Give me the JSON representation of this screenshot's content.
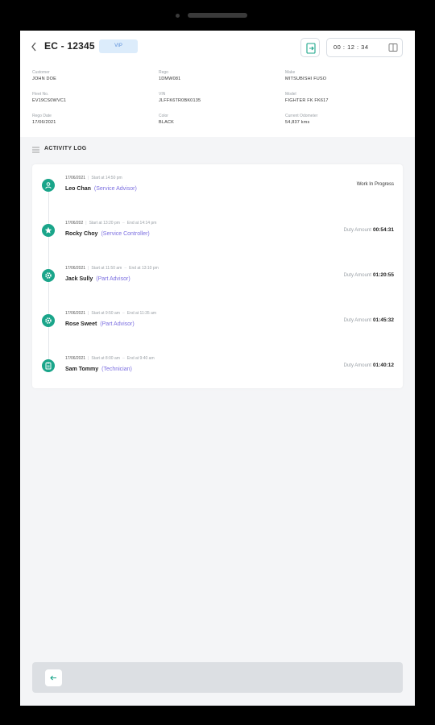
{
  "header": {
    "title": "EC - 12345",
    "badge": "VIP",
    "timer": "00 : 12 : 34"
  },
  "info": {
    "customer": {
      "label": "Customer",
      "value": "JOHN DOE"
    },
    "rego": {
      "label": "Rego",
      "value": "1DMW081"
    },
    "make": {
      "label": "Make",
      "value": "MITSUBISHI FUSO"
    },
    "fleet_no": {
      "label": "Fleet No.",
      "value": "EV19CS0WVC1"
    },
    "vin": {
      "label": "VIN",
      "value": "JLFFK6TR0BK0135"
    },
    "model": {
      "label": "Model",
      "value": "FIGHTER FK FK617"
    },
    "rego_date": {
      "label": "Rego Date",
      "value": "17/06/2021"
    },
    "color": {
      "label": "Color",
      "value": "BLACK"
    },
    "odometer": {
      "label": "Current Odometer",
      "value": "54,837 kms"
    }
  },
  "activity_log": {
    "title": "ACTIVITY LOG",
    "entries": [
      {
        "date": "17/06/2021",
        "start": "Start at 14:50 pm",
        "end": "",
        "name": "Leo Chan",
        "role": "(Service Advisor)",
        "status": "Work In Progress",
        "duty_label": "",
        "duty_value": "",
        "icon": "person-icon"
      },
      {
        "date": "17/06/202",
        "start": "Start at 13:20 pm",
        "end": "End at 14:14 pm",
        "name": "Rocky Choy",
        "role": "(Service Controller)",
        "status": "",
        "duty_label": "Duty Amount",
        "duty_value": "00:54:31",
        "icon": "star-icon"
      },
      {
        "date": "17/06/2021",
        "start": "Start at 11:50 am",
        "end": "End at 13:10 pm",
        "name": "Jack Sully",
        "role": "(Part Advisor)",
        "status": "",
        "duty_label": "Duty Amount",
        "duty_value": "01:20:55",
        "icon": "gear-icon"
      },
      {
        "date": "17/06/2021",
        "start": "Start at 9:50 am",
        "end": "End at 11:35 am",
        "name": "Rose Sweet",
        "role": "(Part Advisor)",
        "status": "",
        "duty_label": "Duty Amount",
        "duty_value": "01:45:32",
        "icon": "gear-icon"
      },
      {
        "date": "17/06/2021",
        "start": "Start at 8:00 am",
        "end": "End at 9:40 am",
        "name": "Sam Tommy",
        "role": "(Technician)",
        "status": "",
        "duty_label": "Duty Amount",
        "duty_value": "01:40:12",
        "icon": "clipboard-icon"
      }
    ]
  },
  "colors": {
    "accent_teal": "#1aa58a",
    "role_purple": "#7b6ee0",
    "badge_bg": "#dcecfb"
  }
}
